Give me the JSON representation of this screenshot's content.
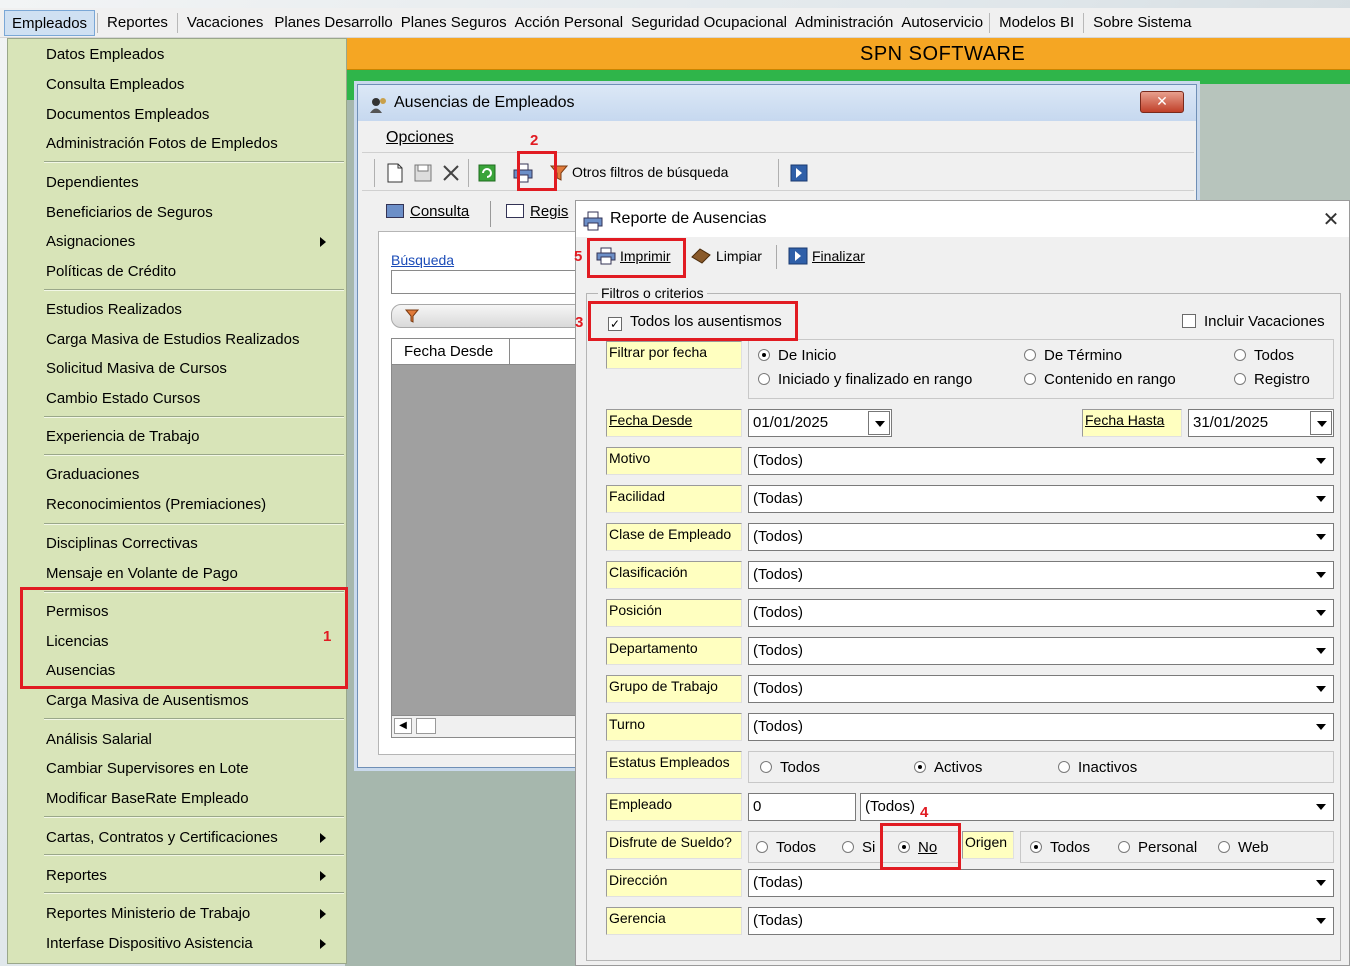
{
  "menubar": {
    "items": [
      "Empleados",
      "Reportes",
      "Vacaciones",
      "Planes Desarrollo",
      "Planes Seguros",
      "Acción Personal",
      "Seguridad Ocupacional",
      "Administración",
      "Autoservicio",
      "Modelos BI",
      "Sobre Sistema"
    ]
  },
  "background": {
    "banner_text": "SPN SOFTWARE"
  },
  "dropdown": {
    "items": [
      "Datos Empleados",
      "Consulta Empleados",
      "Documentos Empleados",
      "Administración Fotos de Empledos",
      "Dependientes",
      "Beneficiarios de Seguros",
      "Asignaciones",
      "Políticas de Crédito",
      "Estudios Realizados",
      "Carga Masiva de Estudios Realizados",
      "Solicitud Masiva de Cursos",
      "Cambio Estado Cursos",
      "Experiencia de Trabajo",
      "Graduaciones",
      "Reconocimientos (Premiaciones)",
      "Disciplinas Correctivas",
      "Mensaje en Volante de Pago",
      "Permisos",
      "Licencias",
      "Ausencias",
      "Carga Masiva de Ausentismos",
      "Análisis Salarial",
      "Cambiar Supervisores en Lote",
      "Modificar BaseRate Empleado",
      "Cartas, Contratos y Certificaciones",
      "Reportes",
      "Reportes Ministerio de Trabajo",
      "Interfase Dispositivo Asistencia"
    ]
  },
  "annotations": {
    "n1": "1",
    "n2": "2",
    "n3": "3",
    "n4": "4",
    "n5": "5"
  },
  "window1": {
    "title": "Ausencias de Empleados",
    "menu_label": "Opciones",
    "toolbar_filter_label": "Otros filtros de búsqueda",
    "tab_consulta": "Consulta",
    "tab_registro": "Regis",
    "search_label": "Búsqueda",
    "search_value": "",
    "grid_col": "Fecha Desde"
  },
  "window2": {
    "title": "Reporte de Ausencias",
    "btn_print": "Imprimir",
    "btn_clear": "Limpiar",
    "btn_finish": "Finalizar",
    "group_title": "Filtros o criterios",
    "chk_all_absences": "Todos los ausentismos",
    "chk_include_vacations": "Incluir Vacaciones",
    "lbl_filter_date": "Filtrar por fecha",
    "r_inicio": "De Inicio",
    "r_termino": "De Término",
    "r_todos_fecha": "Todos",
    "r_rango": "Iniciado y finalizado en rango",
    "r_contenido": "Contenido en rango",
    "r_registro": "Registro",
    "lbl_fecha_desde": "Fecha Desde",
    "fecha_desde": "01/01/2025",
    "lbl_fecha_hasta": "Fecha Hasta",
    "fecha_hasta": "31/01/2025",
    "lbl_motivo": "Motivo",
    "motivo": "(Todos)",
    "lbl_facilidad": "Facilidad",
    "facilidad": "(Todas)",
    "lbl_clase": "Clase de Empleado",
    "clase": "(Todos)",
    "lbl_clasificacion": "Clasificación",
    "clasificacion": "(Todos)",
    "lbl_posicion": "Posición",
    "posicion": "(Todos)",
    "lbl_departamento": "Departamento",
    "departamento": "(Todos)",
    "lbl_grupo": "Grupo de Trabajo",
    "grupo": "(Todos)",
    "lbl_turno": "Turno",
    "turno": "(Todos)",
    "lbl_estatus": "Estatus Empleados",
    "est_todos": "Todos",
    "est_activos": "Activos",
    "est_inactivos": "Inactivos",
    "lbl_empleado": "Empleado",
    "empleado_id": "0",
    "empleado_combo": "(Todos)",
    "lbl_disfrute": "Disfrute de Sueldo?",
    "dis_todos": "Todos",
    "dis_si": "Si",
    "dis_no": "No",
    "lbl_origen": "Origen",
    "ori_todos": "Todos",
    "ori_personal": "Personal",
    "ori_web": "Web",
    "lbl_direccion": "Dirección",
    "direccion": "(Todas)",
    "lbl_gerencia": "Gerencia",
    "gerencia": "(Todas)"
  }
}
